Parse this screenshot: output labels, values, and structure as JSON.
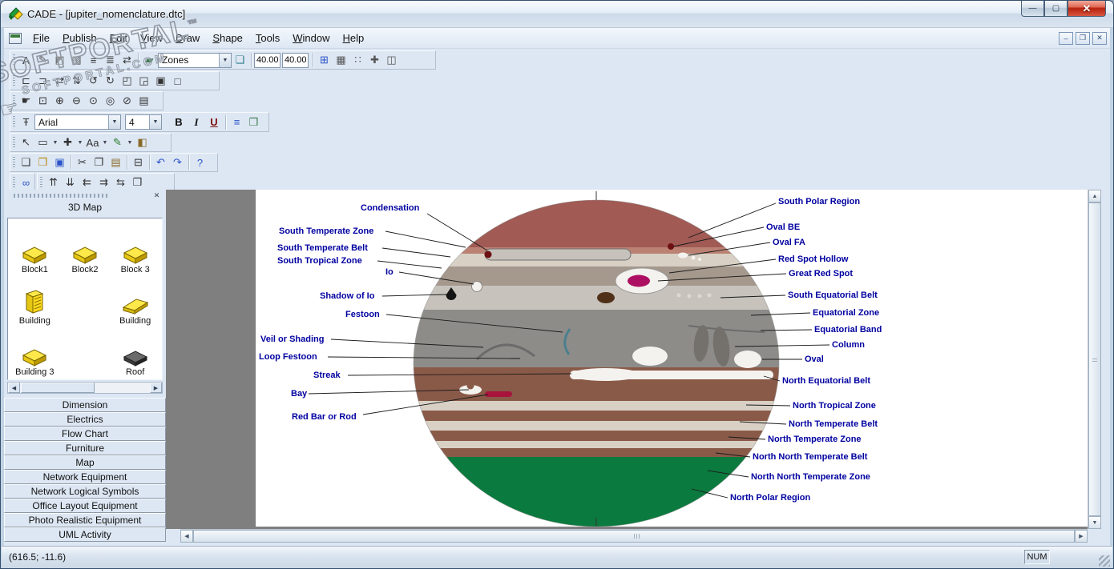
{
  "window": {
    "title": "CADE - [jupiter_nomenclature.dtc]"
  },
  "menus": [
    "File",
    "Publish",
    "Edit",
    "View",
    "Draw",
    "Shape",
    "Tools",
    "Window",
    "Help"
  ],
  "format_bar": {
    "zones": "Zones",
    "width": "40.00",
    "height": "40.00"
  },
  "text_bar": {
    "font": "Arial",
    "size": "4",
    "bold": "B",
    "italic": "I",
    "underline": "U"
  },
  "bars": {
    "format": [
      {
        "n": "text-tool-icon",
        "g": "A",
        "c": "#1a1a1a"
      },
      {
        "n": "pencil-icon",
        "g": "✎",
        "c": "#555555"
      },
      {
        "n": "shade-icon",
        "g": "◩",
        "c": "#777777"
      },
      {
        "n": "hatch-icon",
        "g": "▨",
        "c": "#555555"
      },
      {
        "n": "line-style-icon",
        "g": "≡",
        "c": "#333333"
      },
      {
        "n": "line-width-icon",
        "g": "≣",
        "c": "#333333"
      },
      {
        "n": "arrow-style-icon",
        "g": "⇄",
        "c": "#333333"
      }
    ],
    "format2a": [
      {
        "n": "zone-filter-icon",
        "g": "▰",
        "c": "#3a7a4a"
      }
    ],
    "format2b": [
      {
        "n": "layers-icon",
        "g": "❏",
        "c": "#2a7a8a"
      }
    ],
    "format3": [
      {
        "n": "grid-icon",
        "g": "⊞",
        "c": "#2a52c8"
      },
      {
        "n": "grid-snap-icon",
        "g": "▦",
        "c": "#555555"
      },
      {
        "n": "snap-points-icon",
        "g": "∷",
        "c": "#555555"
      },
      {
        "n": "snap-cross-icon",
        "g": "✚",
        "c": "#555555"
      },
      {
        "n": "guides-icon",
        "g": "◫",
        "c": "#555555"
      }
    ],
    "arrange": [
      {
        "n": "align-left-icon",
        "g": "⊏"
      },
      {
        "n": "align-right-icon",
        "g": "⊐"
      },
      {
        "n": "flip-horizontal-icon",
        "g": "⇄"
      },
      {
        "n": "flip-vertical-icon",
        "g": "⇅"
      },
      {
        "n": "rotate-left-icon",
        "g": "↺"
      },
      {
        "n": "rotate-right-icon",
        "g": "↻"
      },
      {
        "n": "bring-to-front-icon",
        "g": "◰"
      },
      {
        "n": "send-to-back-icon",
        "g": "◲"
      },
      {
        "n": "group-icon",
        "g": "▣"
      },
      {
        "n": "ungroup-icon",
        "g": "□"
      }
    ],
    "zoom": [
      {
        "n": "pan-icon",
        "g": "☛"
      },
      {
        "n": "zoom-area-icon",
        "g": "⊡"
      },
      {
        "n": "zoom-in-icon",
        "g": "⊕"
      },
      {
        "n": "zoom-out-icon",
        "g": "⊖"
      },
      {
        "n": "zoom-actual-icon",
        "g": "⊙"
      },
      {
        "n": "zoom-fit-icon",
        "g": "◎"
      },
      {
        "n": "zoom-selection-icon",
        "g": "⊘"
      },
      {
        "n": "page-setup-icon",
        "g": "▤"
      }
    ],
    "textextra": [
      {
        "n": "text-align-icon",
        "g": "≡",
        "c": "#2a52c8"
      },
      {
        "n": "text-frame-icon",
        "g": "❒",
        "c": "#3a7a4a"
      }
    ],
    "select": [
      {
        "n": "select-tool-icon",
        "g": "↖"
      },
      {
        "n": "shape-tool-icon",
        "g": "▭",
        "dd": 1
      },
      {
        "n": "move-tool-icon",
        "g": "✚",
        "dd": 1
      },
      {
        "n": "text-style-icon",
        "g": "Aa",
        "dd": 1
      },
      {
        "n": "pen-color-icon",
        "g": "✎",
        "c": "#2a7a2a",
        "dd": 1
      },
      {
        "n": "format-painter-icon",
        "g": "◧",
        "c": "#8a6a2a"
      }
    ],
    "standard": [
      {
        "n": "new-icon",
        "g": "❑"
      },
      {
        "n": "open-icon",
        "g": "❒",
        "c": "#b8860b"
      },
      {
        "n": "save-icon",
        "g": "▣",
        "c": "#2a52c8"
      },
      {
        "sep": 1
      },
      {
        "n": "cut-icon",
        "g": "✂"
      },
      {
        "n": "copy-icon",
        "g": "❐"
      },
      {
        "n": "paste-icon",
        "g": "▤",
        "c": "#8a6a2a"
      },
      {
        "sep": 1
      },
      {
        "n": "print-icon",
        "g": "⊟"
      },
      {
        "sep": 1
      },
      {
        "n": "undo-icon",
        "g": "↶",
        "c": "#2a52c8"
      },
      {
        "n": "redo-icon",
        "g": "↷",
        "c": "#2a52c8"
      },
      {
        "sep": 1
      },
      {
        "n": "help-icon",
        "g": "?",
        "c": "#2a52c8"
      }
    ],
    "connect1": [
      {
        "n": "connector-icon",
        "g": "∞",
        "c": "#2a52c8"
      }
    ],
    "connect2": [
      {
        "n": "line-up-icon",
        "g": "⇈"
      },
      {
        "n": "line-down-icon",
        "g": "⇊"
      },
      {
        "n": "indent-icon",
        "g": "⇇"
      },
      {
        "n": "outdent-icon",
        "g": "⇉"
      },
      {
        "n": "swap-icon",
        "g": "⇆"
      },
      {
        "n": "diagram-props-icon",
        "g": "❒"
      }
    ]
  },
  "watermark": {
    "title": "SOFTPORTAL",
    "tm": "™",
    "subtitle": "SOFTPORTAL.COM",
    "hand": "☛"
  },
  "sidebar": {
    "title": "3D Map",
    "shapes": [
      {
        "label": "Block1",
        "icon": "block"
      },
      {
        "label": "Block2",
        "icon": "block"
      },
      {
        "label": "Block 3",
        "icon": "block"
      },
      {
        "label": "Building",
        "icon": "building"
      },
      {
        "label": "Building",
        "icon": "slab"
      },
      {
        "label": "Building 3",
        "icon": "block"
      },
      {
        "label": "Roof",
        "icon": "roof"
      }
    ],
    "categories": [
      "Dimension",
      "Electrics",
      "Flow Chart",
      "Furniture",
      "Map",
      "Network Equipment",
      "Network Logical Symbols",
      "Office Layout Equipment",
      "Photo Realistic Equipment",
      "UML Activity"
    ]
  },
  "diagram": {
    "labels_left": [
      "Condensation",
      "South Temperate Zone",
      "South Temperate Belt",
      "South Tropical Zone",
      "Io",
      "Shadow of Io",
      "Festoon",
      "Veil or Shading",
      "Loop Festoon",
      "Streak",
      "Bay",
      "Red Bar or Rod"
    ],
    "labels_right": [
      "South Polar Region",
      "Oval BE",
      "Oval FA",
      "Red Spot Hollow",
      "Great Red Spot",
      "South Equatorial Belt",
      "Equatorial Zone",
      "Equatorial Band",
      "Column",
      "Oval",
      "North Equatorial Belt",
      "North Tropical Zone",
      "North Temperate Belt",
      "North Temperate Zone",
      "North North Temperate Belt",
      "North North Temperate Zone",
      "North Polar Region"
    ]
  },
  "colors": {
    "label_text": "#0000a0",
    "south_polar": "#a15a54",
    "south_polar_edge": "#bb8274",
    "zone_cream": "#d8d0c4",
    "zone_tan": "#a5988c",
    "zone_lightgray": "#c7c3bc",
    "equatorial_gray": "#8e8c89",
    "belt_brown": "#8a5a49",
    "north_polar": "#0b7a3e",
    "capsule_gray": "#c6c2bb",
    "oval_white": "#f4f2ee",
    "dot_gray": "#dcd9d3",
    "barge_red": "#6e0f12",
    "great_red_spot": "#ad0f63",
    "red_bar": "#a8143c",
    "festoon_teal": "#4a7f8e",
    "veil_gray": "#6b6b6b",
    "column_gray": "#74716d",
    "brown_blob": "#503018",
    "shadow_black": "#141414"
  },
  "statusbar": {
    "coords": "(616.5; -11.6)",
    "num": "NUM"
  }
}
